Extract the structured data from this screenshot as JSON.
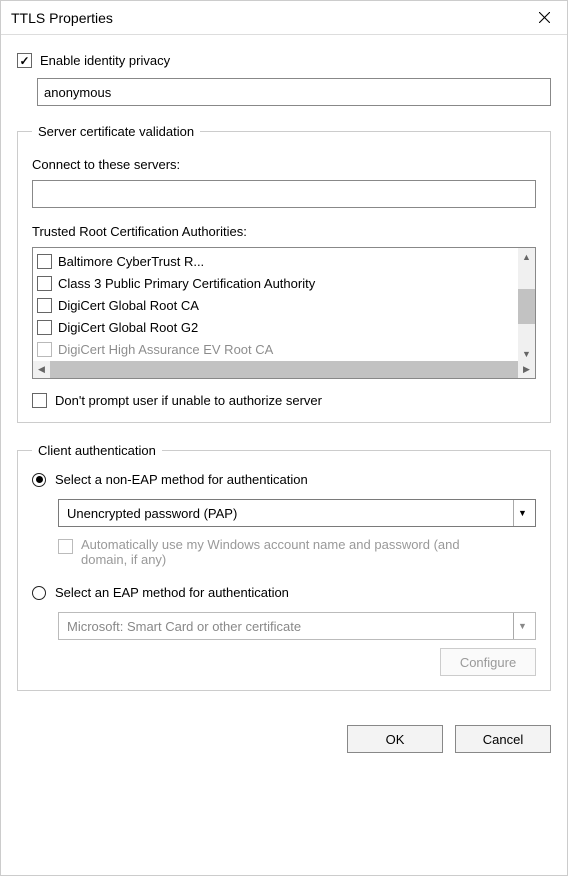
{
  "window": {
    "title": "TTLS Properties"
  },
  "identity": {
    "checkbox_label": "Enable identity privacy",
    "value": "anonymous"
  },
  "server_group": {
    "legend": "Server certificate validation",
    "connect_label": "Connect to these servers:",
    "connect_value": "",
    "trusted_label": "Trusted Root Certification Authorities:",
    "authorities": [
      "Baltimore CyberTrust R...",
      "Class 3 Public Primary Certification Authority",
      "DigiCert Global Root CA",
      "DigiCert Global Root G2",
      "DigiCert High Assurance EV Root CA"
    ],
    "dont_prompt_label": "Don't prompt user if unable to authorize server"
  },
  "client_group": {
    "legend": "Client authentication",
    "non_eap_label": "Select a non-EAP method for authentication",
    "non_eap_selected": "Unencrypted password (PAP)",
    "auto_windows_label": "Automatically use my Windows account name and password (and domain, if any)",
    "eap_label": "Select an EAP method for authentication",
    "eap_selected": "Microsoft: Smart Card or other certificate",
    "configure_label": "Configure"
  },
  "buttons": {
    "ok": "OK",
    "cancel": "Cancel"
  }
}
